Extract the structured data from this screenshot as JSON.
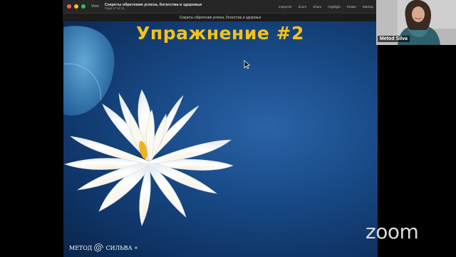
{
  "window": {
    "view_menu": "View",
    "document_title": "Секреты обретения успеха, богатства и здоровья",
    "page_indicator": "Page 27 of 31",
    "toolbar": [
      "Inspector",
      "Zoom",
      "Share",
      "Highlight",
      "Rotate",
      "Markup"
    ],
    "tab_title": "Секреты обретения успеха, богатства и здоровья"
  },
  "slide": {
    "heading": "Упражнение #2",
    "brand_left": "МЕТОД",
    "brand_right": "СИЛЬВА",
    "brand_registered": "®",
    "heading_color": "#f3c21b",
    "background_color": "#184a86"
  },
  "participant": {
    "name": "Metod Silva"
  },
  "zoom_logo": "zoom"
}
